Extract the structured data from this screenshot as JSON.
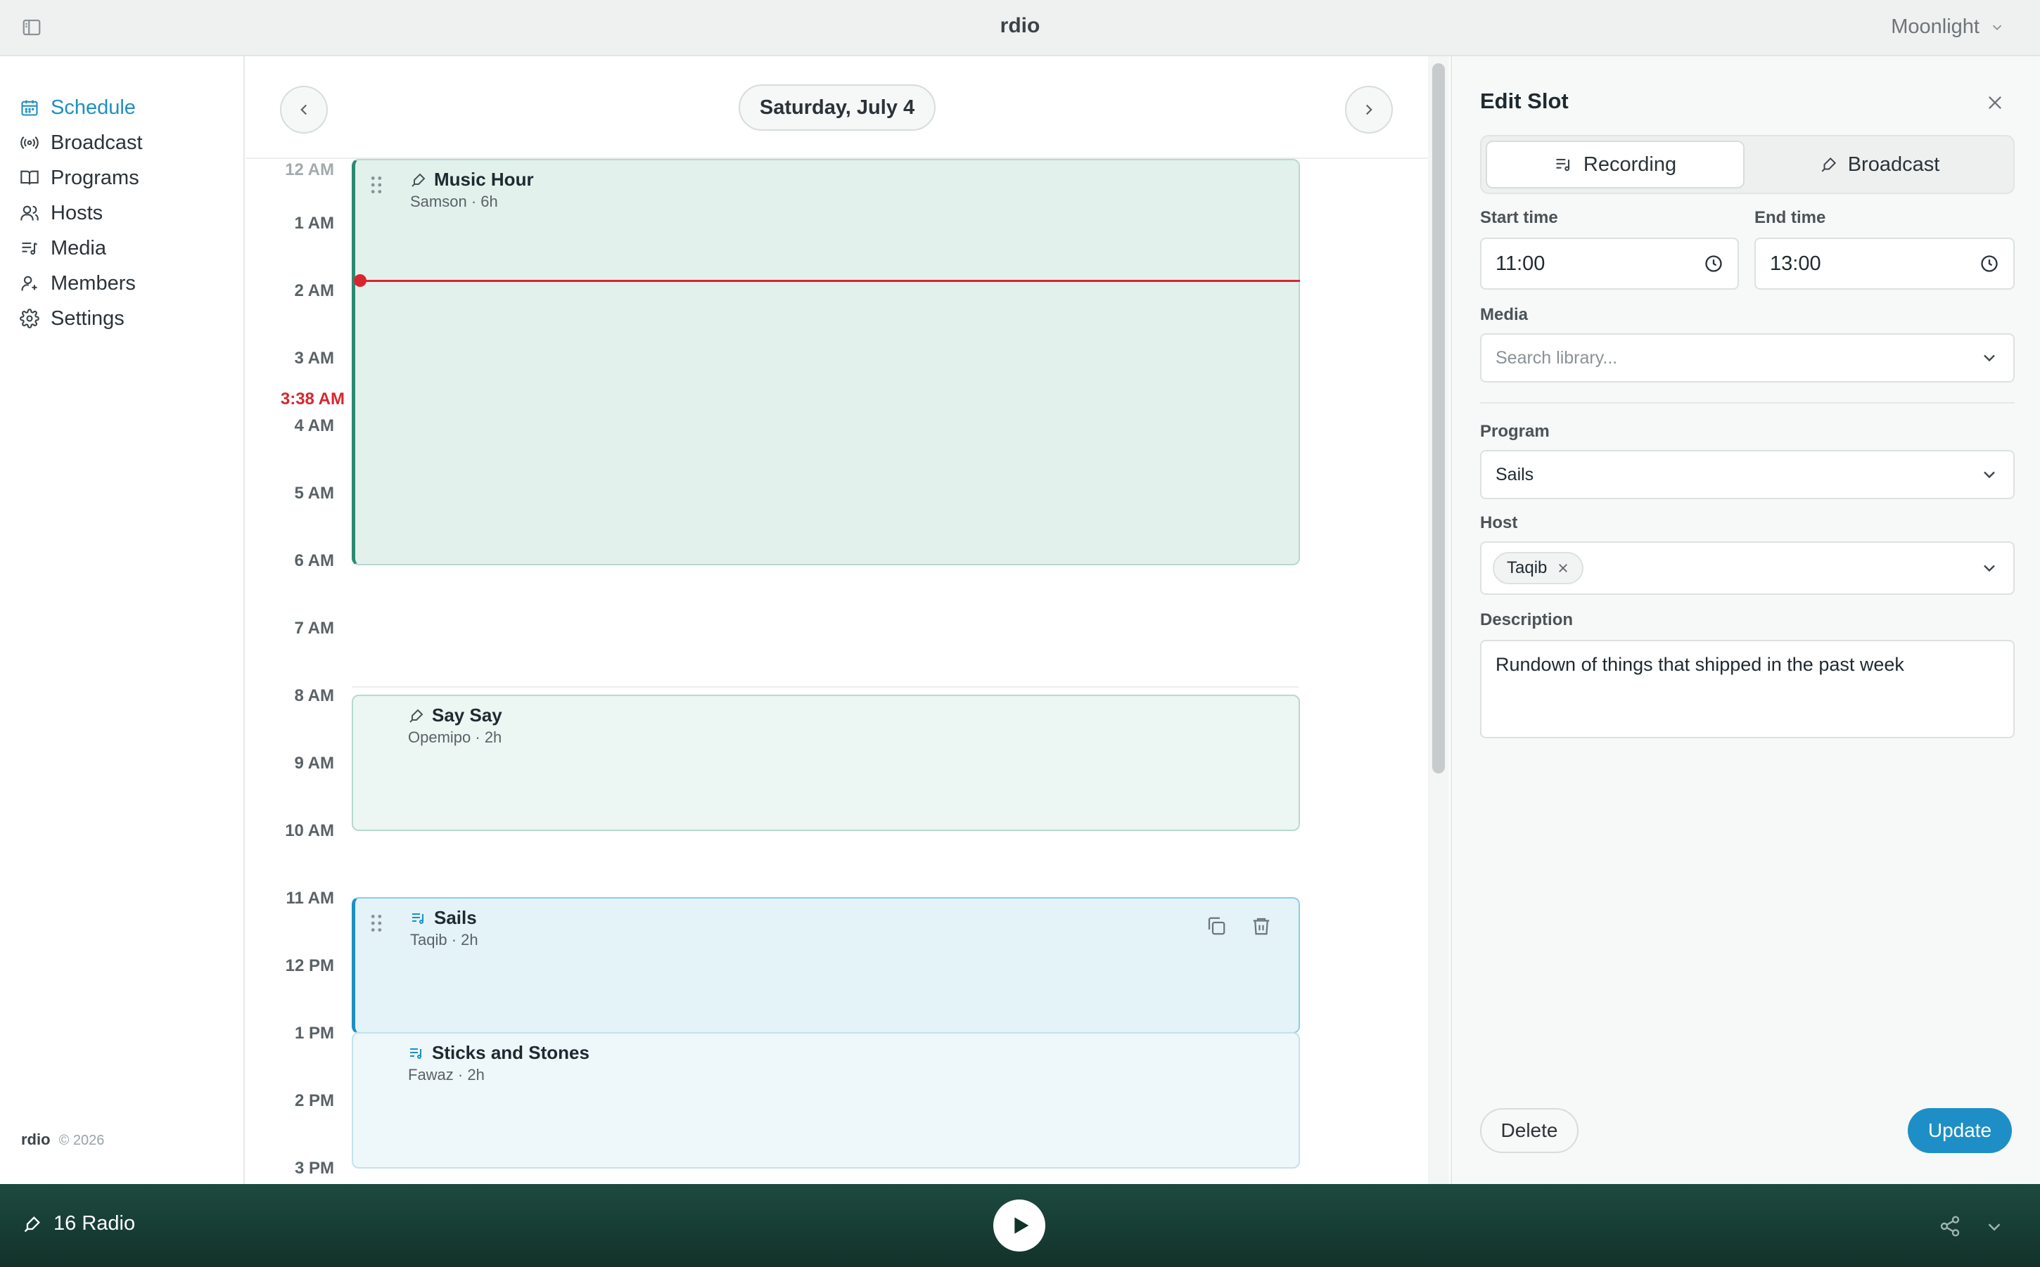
{
  "app": {
    "title": "rdio",
    "theme": "Moonlight"
  },
  "sidebar": {
    "items": [
      {
        "label": "Schedule",
        "icon": "calendar-icon",
        "active": true
      },
      {
        "label": "Broadcast",
        "icon": "broadcast-icon",
        "active": false
      },
      {
        "label": "Programs",
        "icon": "book-icon",
        "active": false
      },
      {
        "label": "Hosts",
        "icon": "users-icon",
        "active": false
      },
      {
        "label": "Media",
        "icon": "music-list-icon",
        "active": false
      },
      {
        "label": "Members",
        "icon": "user-plus-icon",
        "active": false
      },
      {
        "label": "Settings",
        "icon": "gear-icon",
        "active": false
      }
    ],
    "footer": {
      "brand": "rdio",
      "copyright": "© 2026"
    }
  },
  "schedule": {
    "date": "Saturday, July 4",
    "hours": [
      "12 AM",
      "1 AM",
      "2 AM",
      "3 AM",
      "4 AM",
      "5 AM",
      "6 AM",
      "7 AM",
      "8 AM",
      "9 AM",
      "10 AM",
      "11 AM",
      "12 PM",
      "1 PM",
      "2 PM",
      "3 PM"
    ],
    "now_label": "3:38 AM",
    "slots": [
      {
        "title": "Music Hour",
        "subtitle": "Samson · 6h",
        "type": "broadcast",
        "icon": "mic-icon"
      },
      {
        "title": "Say Say",
        "subtitle": "Opemipo · 2h",
        "type": "broadcast",
        "icon": "mic-icon"
      },
      {
        "title": "Sails",
        "subtitle": "Taqib · 2h",
        "type": "recording",
        "icon": "music-list-icon"
      },
      {
        "title": "Sticks and Stones",
        "subtitle": "Fawaz · 2h",
        "type": "recording",
        "icon": "music-list-icon"
      }
    ]
  },
  "edit_panel": {
    "title": "Edit Slot",
    "mode_tabs": [
      {
        "label": "Recording",
        "icon": "music-list-icon",
        "selected": true
      },
      {
        "label": "Broadcast",
        "icon": "mic-icon",
        "selected": false
      }
    ],
    "start_time": {
      "label": "Start time",
      "value": "11:00"
    },
    "end_time": {
      "label": "End time",
      "value": "13:00"
    },
    "media": {
      "label": "Media",
      "placeholder": "Search library..."
    },
    "program": {
      "label": "Program",
      "value": "Sails"
    },
    "host": {
      "label": "Host",
      "chip": "Taqib"
    },
    "description": {
      "label": "Description",
      "value": "Rundown of things that shipped in the past week"
    },
    "delete_label": "Delete",
    "update_label": "Update"
  },
  "player": {
    "station": "16 Radio"
  },
  "colors": {
    "accent": "#1e8fc6",
    "now_line": "#d8262e",
    "broadcast_slot": "#e3f1ed",
    "recording_slot": "#e3f3f8",
    "player_bg": "#1d4a40"
  }
}
